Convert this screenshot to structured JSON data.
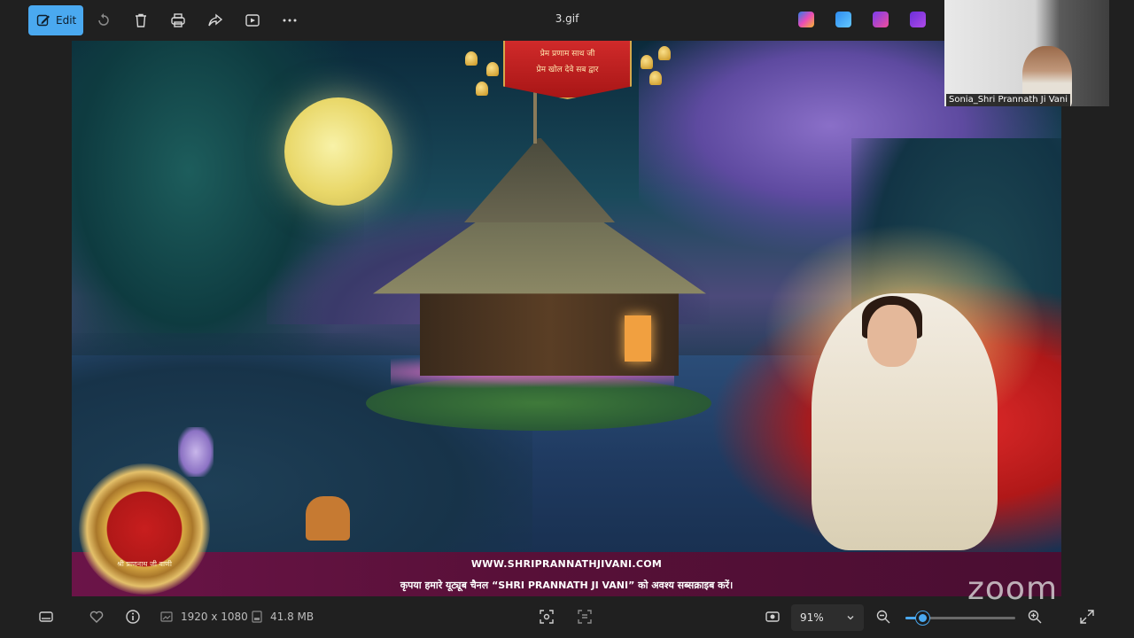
{
  "toolbar": {
    "edit_label": "Edit",
    "file_title": "3.gif",
    "icons": [
      "edit-icon",
      "rotate-icon",
      "delete-icon",
      "print-icon",
      "share-icon",
      "slideshow-icon",
      "more-icon"
    ],
    "apps": [
      "copilot-icon",
      "paint-icon",
      "designer-icon",
      "clipchamp-icon"
    ]
  },
  "image": {
    "banner_line1": "प्रेम प्रणाम साथ जी",
    "banner_line2": "प्रेम खोल देवे सब द्वार",
    "logo_text": "श्री प्राणनाथ जी वाणी",
    "footer_url": "WWW.SHRIPRANNATHJIVANI.COM",
    "footer_msg": "कृपया हमारे यूट्यूब चैनल “SHRI PRANNATH JI VANI” को अवश्य सब्सक्राइब करें।"
  },
  "participant": {
    "name": "Sonia_Shri Prannath Ji Vani"
  },
  "watermark": "zoom",
  "statusbar": {
    "dimensions": "1920 x 1080",
    "size": "41.8 MB",
    "zoom": "91%",
    "zoom_fraction": 0.16
  },
  "colors": {
    "accent": "#4aa9f0",
    "footer_band": "#6b1448"
  }
}
